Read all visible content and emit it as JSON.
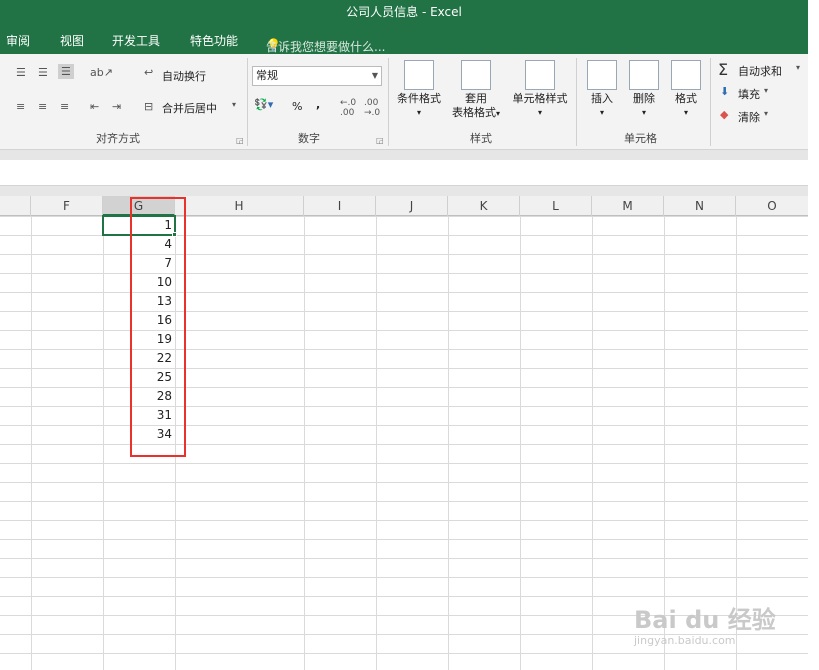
{
  "window": {
    "title": "公司人员信息 - Excel"
  },
  "menu": {
    "items": [
      "审阅",
      "视图",
      "开发工具",
      "特色功能"
    ],
    "tell_me": "告诉我您想要做什么..."
  },
  "ribbon": {
    "alignment": {
      "label": "对齐方式",
      "wrap_text": "自动换行",
      "merge_center": "合并后居中"
    },
    "number": {
      "label": "数字",
      "format_value": "常规",
      "percent": "%",
      "comma": ","
    },
    "styles": {
      "label": "样式",
      "conditional": "条件格式",
      "table_format_1": "套用",
      "table_format_2": "表格格式",
      "cell_styles": "单元格样式"
    },
    "cells": {
      "label": "单元格",
      "insert": "插入",
      "delete": "删除",
      "format": "格式"
    },
    "editing": {
      "autosum": "自动求和",
      "fill": "填充",
      "clear": "清除"
    }
  },
  "columns": [
    "F",
    "G",
    "H",
    "I",
    "J",
    "K",
    "L",
    "M",
    "N",
    "O"
  ],
  "column_g_values": [
    "1",
    "4",
    "7",
    "10",
    "13",
    "16",
    "19",
    "22",
    "25",
    "28",
    "31",
    "34"
  ],
  "watermark": {
    "brand": "Bai du 经验",
    "url": "jingyan.baidu.com"
  }
}
